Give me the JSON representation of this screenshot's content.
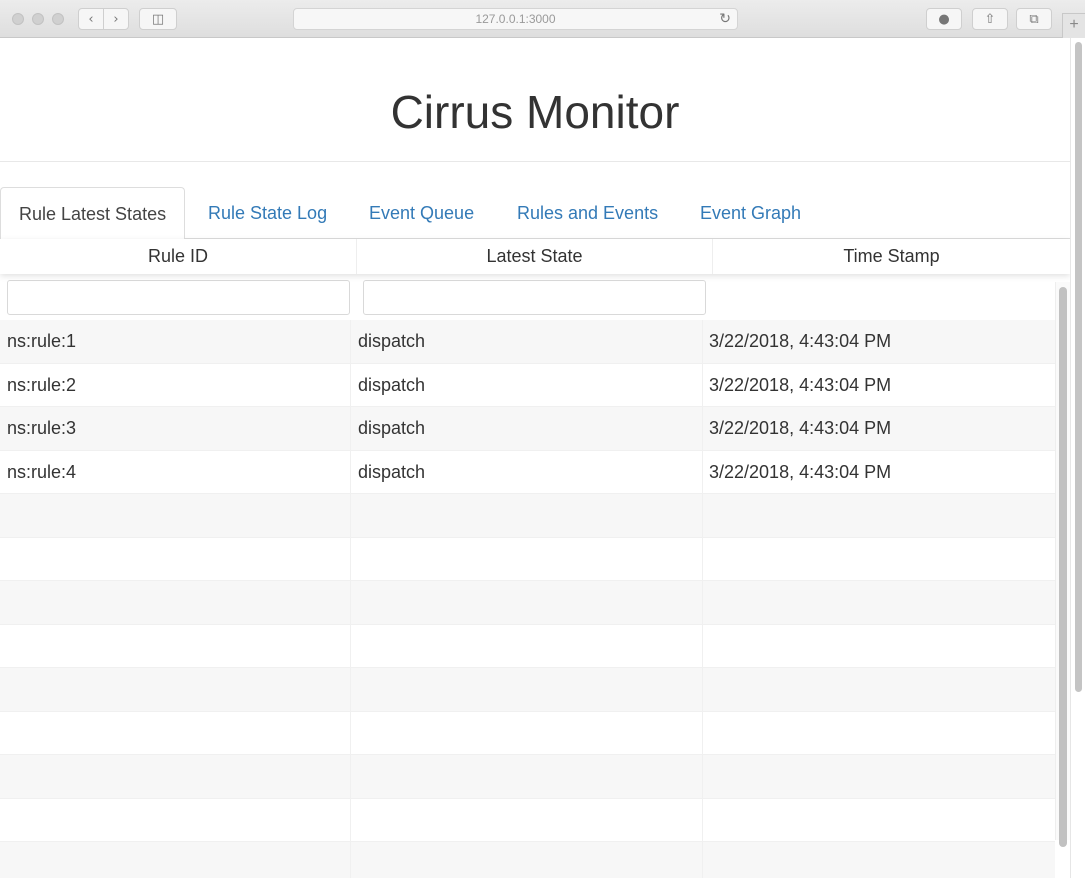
{
  "browser": {
    "url": "127.0.0.1:3000",
    "back_icon": "chevron-left-icon",
    "forward_icon": "chevron-right-icon",
    "reload_icon": "reload-icon",
    "new_tab_label": "+"
  },
  "page": {
    "title": "Cirrus Monitor"
  },
  "tabs": [
    {
      "label": "Rule Latest States",
      "active": true
    },
    {
      "label": "Rule State Log",
      "active": false
    },
    {
      "label": "Event Queue",
      "active": false
    },
    {
      "label": "Rules and Events",
      "active": false
    },
    {
      "label": "Event Graph",
      "active": false
    }
  ],
  "table": {
    "columns": [
      "Rule ID",
      "Latest State",
      "Time Stamp"
    ],
    "filters": {
      "rule_id": "",
      "latest_state": ""
    },
    "rows": [
      [
        "ns:rule:1",
        "dispatch",
        "3/22/2018, 4:43:04 PM"
      ],
      [
        "ns:rule:2",
        "dispatch",
        "3/22/2018, 4:43:04 PM"
      ],
      [
        "ns:rule:3",
        "dispatch",
        "3/22/2018, 4:43:04 PM"
      ],
      [
        "ns:rule:4",
        "dispatch",
        "3/22/2018, 4:43:04 PM"
      ],
      [
        "",
        "",
        ""
      ],
      [
        "",
        "",
        ""
      ],
      [
        "",
        "",
        ""
      ],
      [
        "",
        "",
        ""
      ],
      [
        "",
        "",
        ""
      ],
      [
        "",
        "",
        ""
      ],
      [
        "",
        "",
        ""
      ],
      [
        "",
        "",
        ""
      ],
      [
        "",
        "",
        ""
      ]
    ]
  },
  "colors": {
    "link": "#337ab7",
    "stripe": "#f7f7f7"
  }
}
